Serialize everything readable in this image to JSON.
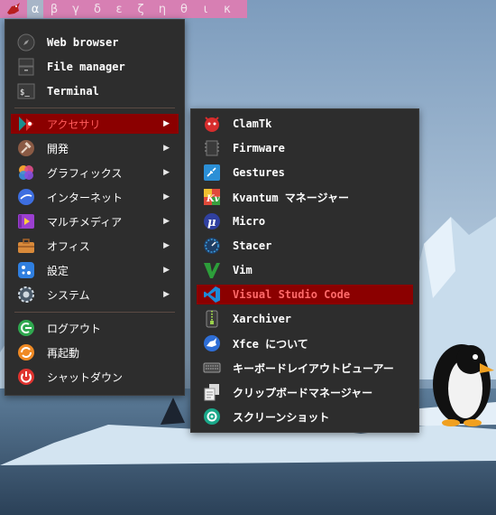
{
  "panel": {
    "workspaces": [
      "α",
      "β",
      "γ",
      "δ",
      "ε",
      "ζ",
      "η",
      "θ",
      "ι",
      "κ"
    ],
    "active_workspace": "α",
    "logo_icon": "xfce-mouse-icon"
  },
  "main_menu": {
    "favorites": [
      {
        "label": "Web browser",
        "icon": "compass-icon"
      },
      {
        "label": "File manager",
        "icon": "file-cabinet-icon"
      },
      {
        "label": "Terminal",
        "icon": "terminal-icon"
      }
    ],
    "categories": [
      {
        "label": "アクセサリ",
        "icon": "accessories-icon",
        "selected": true
      },
      {
        "label": "開発",
        "icon": "hammer-icon"
      },
      {
        "label": "グラフィックス",
        "icon": "graphics-icon"
      },
      {
        "label": "インターネット",
        "icon": "globe-icon"
      },
      {
        "label": "マルチメディア",
        "icon": "multimedia-icon"
      },
      {
        "label": "オフィス",
        "icon": "briefcase-icon"
      },
      {
        "label": "設定",
        "icon": "settings-icon"
      },
      {
        "label": "システム",
        "icon": "system-gear-icon"
      }
    ],
    "session": [
      {
        "label": "ログアウト",
        "icon": "logout-icon"
      },
      {
        "label": "再起動",
        "icon": "restart-icon"
      },
      {
        "label": "シャットダウン",
        "icon": "power-icon"
      }
    ],
    "submenu_arrow": "▶"
  },
  "submenu": {
    "items": [
      {
        "label": "ClamTk",
        "icon": "clamtk-icon"
      },
      {
        "label": "Firmware",
        "icon": "chip-icon"
      },
      {
        "label": "Gestures",
        "icon": "gestures-icon"
      },
      {
        "label": "Kvantum マネージャー",
        "icon": "kvantum-icon"
      },
      {
        "label": "Micro",
        "icon": "micro-icon"
      },
      {
        "label": "Stacer",
        "icon": "stacer-icon"
      },
      {
        "label": "Vim",
        "icon": "vim-icon"
      },
      {
        "label": "Visual Studio Code",
        "icon": "vscode-icon",
        "selected": true
      },
      {
        "label": "Xarchiver",
        "icon": "archive-icon"
      },
      {
        "label": "Xfce について",
        "icon": "xfce-icon"
      },
      {
        "label": "キーボードレイアウトビューアー",
        "icon": "keyboard-icon"
      },
      {
        "label": "クリップボードマネージャー",
        "icon": "clipboard-icon"
      },
      {
        "label": "スクリーンショット",
        "icon": "camera-icon"
      }
    ]
  },
  "colors": {
    "panel": "#d77fb3",
    "menu_bg": "#2d2d2d",
    "selection": "#8b0000",
    "selection_text": "#ff5c5c"
  }
}
